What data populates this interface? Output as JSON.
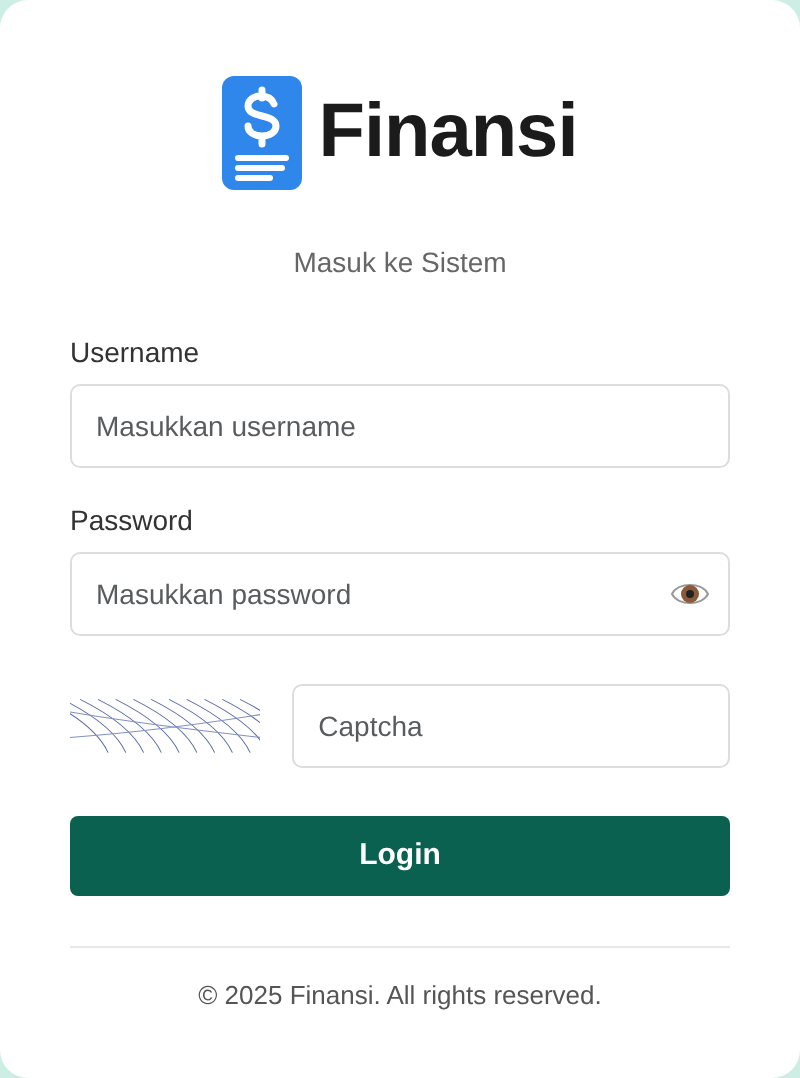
{
  "brand": {
    "name": "Finansi"
  },
  "subtitle": "Masuk ke Sistem",
  "fields": [
    {
      "label": "Username",
      "placeholder": "Masukkan username",
      "kind": "text"
    },
    {
      "label": "Password",
      "placeholder": "Masukkan password",
      "kind": "password"
    }
  ],
  "captcha": {
    "kind": "picture",
    "placeholder": "Captcha"
  },
  "login_button": "Login",
  "footer": "© 2025 Finansi. All rights reserved."
}
